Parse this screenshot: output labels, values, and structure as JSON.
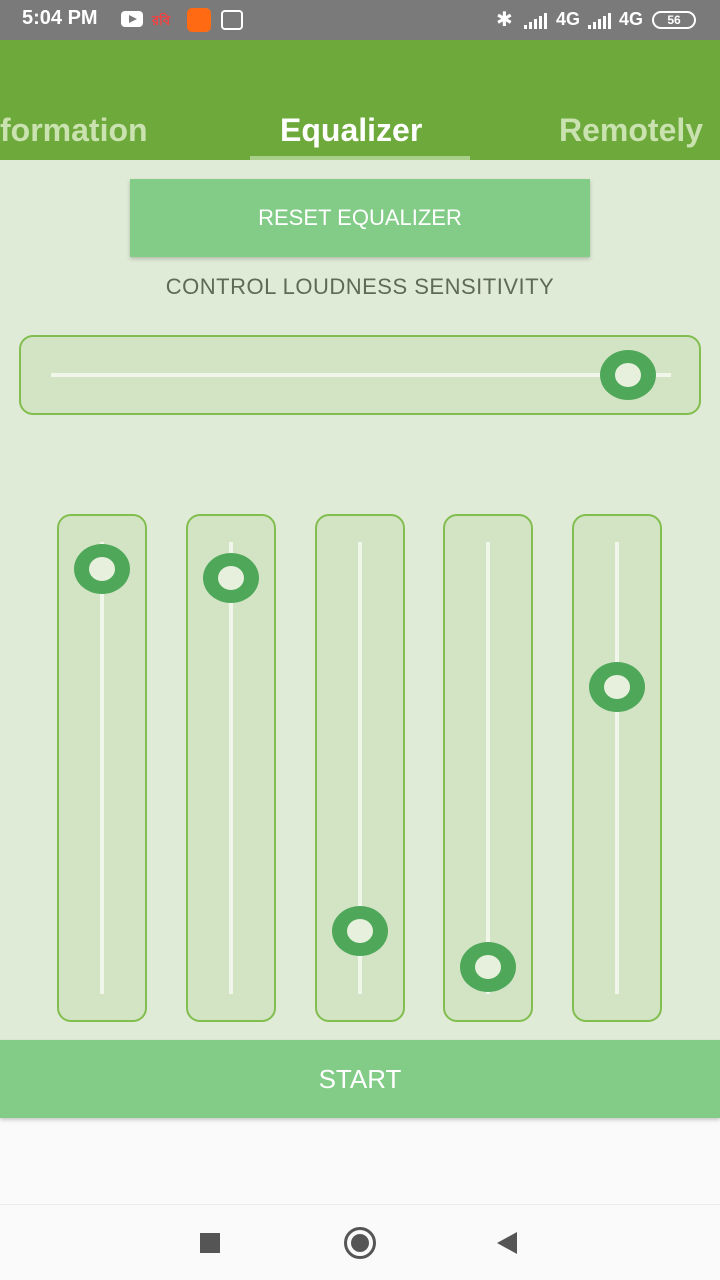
{
  "status_bar": {
    "time": "5:04 PM",
    "robi_label": "রবি",
    "network_1": "4G",
    "network_2": "4G",
    "battery": "56"
  },
  "tabs": [
    {
      "label": "formation",
      "active": false
    },
    {
      "label": "Equalizer",
      "active": true
    },
    {
      "label": "Remotely",
      "active": false
    }
  ],
  "main": {
    "reset_label": "RESET EQUALIZER",
    "loudness_label": "CONTROL LOUDNESS SENSITIVITY",
    "loudness_level": 0.93,
    "bands": [
      {
        "level": 0.94
      },
      {
        "level": 0.92
      },
      {
        "level": 0.14
      },
      {
        "level": 0.06
      },
      {
        "level": 0.68
      }
    ],
    "start_label": "START"
  },
  "colors": {
    "app_bar": "#6ea93b",
    "accent": "#82cc88",
    "knob": "#4fa85a",
    "content_bg": "#e0ebd7"
  }
}
